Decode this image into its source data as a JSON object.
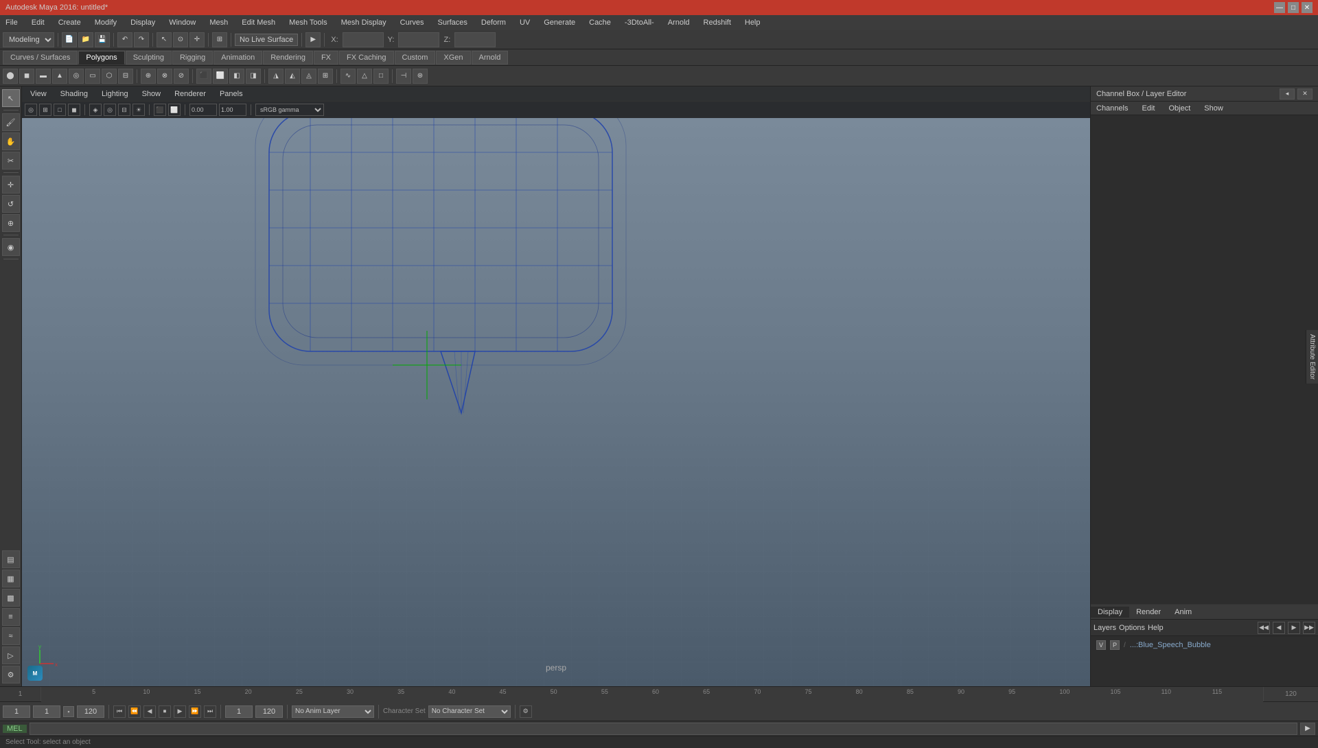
{
  "titlebar": {
    "title": "Autodesk Maya 2016: untitled*",
    "controls": [
      "—",
      "□",
      "✕"
    ]
  },
  "menubar": {
    "items": [
      "File",
      "Edit",
      "Create",
      "Modify",
      "Display",
      "Window",
      "Mesh",
      "Edit Mesh",
      "Mesh Tools",
      "Mesh Display",
      "Curves",
      "Surfaces",
      "Deform",
      "UV",
      "Generate",
      "Cache",
      "-3DtoAll-",
      "Arnold",
      "Redshift",
      "Help"
    ]
  },
  "toolbar1": {
    "mode_select": "Modeling",
    "no_live_surface": "No Live Surface",
    "custom_label": "Custom",
    "x_label": "X:",
    "y_label": "Y:",
    "z_label": "Z:"
  },
  "tabs": {
    "items": [
      "Curves / Surfaces",
      "Polygons",
      "Sculpting",
      "Rigging",
      "Animation",
      "Rendering",
      "FX",
      "FX Caching",
      "Custom",
      "XGen",
      "Arnold"
    ]
  },
  "viewport": {
    "menus": [
      "View",
      "Shading",
      "Lighting",
      "Show",
      "Renderer",
      "Panels"
    ],
    "label": "persp",
    "gamma": "sRGB gamma"
  },
  "right_panel": {
    "title": "Channel Box / Layer Editor",
    "channel_tabs": [
      "Channels",
      "Edit",
      "Object",
      "Show"
    ],
    "bottom_tabs": [
      "Display",
      "Render",
      "Anim"
    ],
    "layer_tabs": [
      "Layers",
      "Options",
      "Help"
    ],
    "layer_items": [
      {
        "v": "V",
        "p": "P",
        "name": "...:Blue_Speech_Bubble"
      }
    ],
    "attr_side_label": "Attribute Editor"
  },
  "bottom_bar": {
    "frame_current": "1",
    "frame_start": "1",
    "layer_icon": "▪",
    "frame_end": "120",
    "playback_start": "1",
    "playback_end": "120",
    "anim_layer": "No Anim Layer",
    "char_set": "No Character Set"
  },
  "cmd_line": {
    "mode": "MEL",
    "placeholder": ""
  },
  "status_bar": {
    "text": "Select Tool: select an object"
  },
  "timeline": {
    "ticks": [
      {
        "pos": 5,
        "label": "5"
      },
      {
        "pos": 10,
        "label": "10"
      },
      {
        "pos": 15,
        "label": "15"
      },
      {
        "pos": 20,
        "label": "20"
      },
      {
        "pos": 25,
        "label": "25"
      },
      {
        "pos": 30,
        "label": "30"
      },
      {
        "pos": 35,
        "label": "35"
      },
      {
        "pos": 40,
        "label": "40"
      },
      {
        "pos": 45,
        "label": "45"
      },
      {
        "pos": 50,
        "label": "50"
      },
      {
        "pos": 55,
        "label": "55"
      },
      {
        "pos": 60,
        "label": "60"
      },
      {
        "pos": 65,
        "label": "65"
      },
      {
        "pos": 70,
        "label": "70"
      },
      {
        "pos": 75,
        "label": "75"
      },
      {
        "pos": 80,
        "label": "80"
      },
      {
        "pos": 85,
        "label": "85"
      },
      {
        "pos": 90,
        "label": "90"
      },
      {
        "pos": 95,
        "label": "95"
      },
      {
        "pos": 100,
        "label": "100"
      },
      {
        "pos": 105,
        "label": "105"
      },
      {
        "pos": 110,
        "label": "110"
      },
      {
        "pos": 115,
        "label": "115"
      },
      {
        "pos": 120,
        "label": "120"
      }
    ]
  }
}
